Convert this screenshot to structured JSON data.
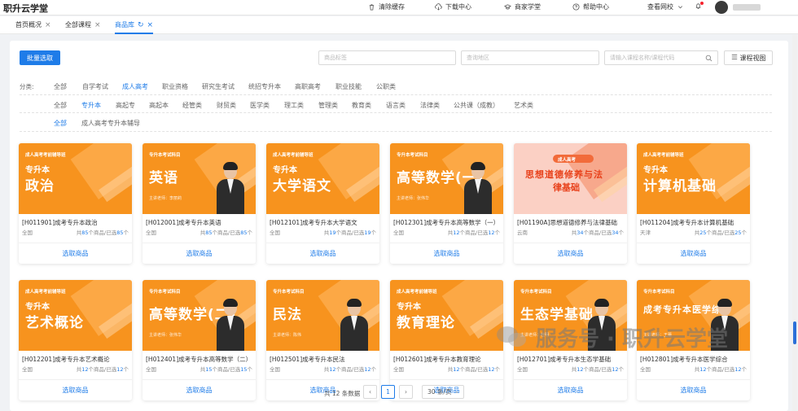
{
  "topbar": {
    "brand": "职升云学堂",
    "items": [
      {
        "label": "清除缓存",
        "icon": "trash-icon"
      },
      {
        "label": "下载中心",
        "icon": "cloud-download-icon"
      },
      {
        "label": "商家学堂",
        "icon": "graduation-cap-icon"
      },
      {
        "label": "帮助中心",
        "icon": "help-icon"
      },
      {
        "label": "查看网校",
        "icon": "chevron-down-icon"
      }
    ]
  },
  "tabs": [
    {
      "label": "首页概况"
    },
    {
      "label": "全部课程"
    },
    {
      "label": "商品库"
    }
  ],
  "toolbar": {
    "batch_button": "批量选取",
    "product_tag_placeholder": "商品标签",
    "region_placeholder": "查询地区",
    "search_placeholder": "请输入课程名称/课程代码",
    "view_button": "课程视图"
  },
  "filters": {
    "label": "分类:",
    "row1": [
      "全部",
      "自学考试",
      "成人高考",
      "职业资格",
      "研究生考试",
      "统招专升本",
      "高职高考",
      "职业技能",
      "公职类"
    ],
    "row1_selected": "成人高考",
    "row2": [
      "全部",
      "专升本",
      "高起专",
      "高起本",
      "经管类",
      "财贸类",
      "医学类",
      "理工类",
      "管理类",
      "教育类",
      "语言类",
      "法律类",
      "公共课（成教）",
      "艺术类"
    ],
    "row2_selected": "专升本",
    "row3": [
      "全部",
      "成人高考专升本辅导"
    ],
    "row3_selected": "全部"
  },
  "products": [
    {
      "tag": "成人高考考前辅导班",
      "sub": "专升本",
      "big": "政治",
      "teacher": "",
      "title": "[H011901]成考专升本政治",
      "region": "全国",
      "total": "85",
      "picked": "85",
      "style": "orange",
      "person": false
    },
    {
      "tag": "专升本考试科目",
      "sub": "",
      "big": "英语",
      "teacher": "主讲老师：李丽莉",
      "title": "[H012001]成考专升本英语",
      "region": "全国",
      "total": "85",
      "picked": "85",
      "style": "orange",
      "person": true
    },
    {
      "tag": "成人高考考前辅导班",
      "sub": "专升本",
      "big": "大学语文",
      "teacher": "",
      "title": "[H012101]成考专升本大学语文",
      "region": "全国",
      "total": "19",
      "picked": "19",
      "style": "orange",
      "person": false
    },
    {
      "tag": "专升本考试科目",
      "sub": "",
      "big": "高等数学(一)",
      "teacher": "主讲老师：张伟华",
      "title": "[H012301]成考专升本高等数学（一）",
      "region": "全国",
      "total": "12",
      "picked": "12",
      "style": "orange",
      "person": true
    },
    {
      "tag": "成人高考",
      "sub": "",
      "big": "思想道德修养与法",
      "big2": "律基础",
      "teacher": "",
      "title": "[H01190A]思想道德修养与法律基础",
      "region": "云南",
      "total": "34",
      "picked": "34",
      "style": "pink",
      "person": false
    },
    {
      "tag": "成人高考考前辅导班",
      "sub": "专升本",
      "big": "计算机基础",
      "teacher": "",
      "title": "[H011204]成考专升本计算机基础",
      "region": "天津",
      "total": "25",
      "picked": "25",
      "style": "orange",
      "person": false
    },
    {
      "tag": "成人高考考前辅导班",
      "sub": "专升本",
      "big": "艺术概论",
      "teacher": "",
      "title": "[H012201]成考专升本艺术概论",
      "region": "全国",
      "total": "12",
      "picked": "12",
      "style": "orange",
      "person": false
    },
    {
      "tag": "专升本考试科目",
      "sub": "",
      "big": "高等数学(二)",
      "teacher": "主讲老师：张伟华",
      "title": "[H012401]成考专升本高等数学（二）",
      "region": "全国",
      "total": "15",
      "picked": "15",
      "style": "orange",
      "person": true
    },
    {
      "tag": "专升本考试科目",
      "sub": "",
      "big": "民法",
      "teacher": "主讲老师：陈伟",
      "title": "[H012501]成考专升本民法",
      "region": "全国",
      "total": "12",
      "picked": "12",
      "style": "orange",
      "person": true
    },
    {
      "tag": "成人高考考前辅导班",
      "sub": "专升本",
      "big": "教育理论",
      "teacher": "",
      "title": "[H012601]成考专升本教育理论",
      "region": "全国",
      "total": "12",
      "picked": "12",
      "style": "orange",
      "person": false
    },
    {
      "tag": "专升本考试科目",
      "sub": "",
      "big": "生态学基础",
      "teacher": "主讲老师：杜明",
      "title": "[H012701]成考专升本生态学基础",
      "region": "全国",
      "total": "12",
      "picked": "12",
      "style": "orange",
      "person": true
    },
    {
      "tag": "专升本考试科目",
      "sub": "",
      "big": "成考专升本医学综合",
      "teacher": "主讲老师：王蕾",
      "title": "[H012801]成考专升本医学综合",
      "region": "全国",
      "total": "12",
      "picked": "12",
      "style": "orange",
      "person": true
    }
  ],
  "product_labels": {
    "total_prefix": "共",
    "total_suffix": "个商品/已选",
    "select": "选取商品"
  },
  "pagination": {
    "total_text": "共 12 条数据",
    "prev": "‹",
    "current": "1",
    "next": "›",
    "page_size": "30 条/页"
  },
  "watermark": "服务号 · 职升云学堂"
}
